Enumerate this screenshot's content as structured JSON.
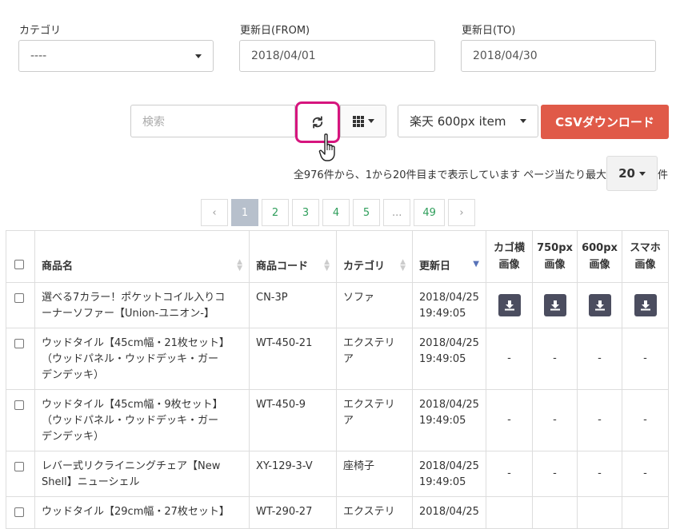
{
  "filters": {
    "category": {
      "label": "カテゴリ",
      "value": "----"
    },
    "date_from": {
      "label": "更新日(FROM)",
      "value": "2018/04/01"
    },
    "date_to": {
      "label": "更新日(TO)",
      "value": "2018/04/30"
    }
  },
  "toolbar": {
    "search_placeholder": "検索",
    "format_select": "楽天 600px item",
    "csv_button": "CSVダウンロード"
  },
  "info": {
    "text": "全976件から、1から20件目まで表示しています ページ当たり最大",
    "per_page": "20",
    "suffix": "件"
  },
  "pagination": {
    "prev": "‹",
    "pages": [
      "1",
      "2",
      "3",
      "4",
      "5",
      "...",
      "49"
    ],
    "current": "1",
    "next": "›"
  },
  "table": {
    "headers": {
      "name": "商品名",
      "code": "商品コード",
      "category": "カテゴリ",
      "updated": "更新日",
      "img1": [
        "カゴ横",
        "画像"
      ],
      "img2": [
        "750px",
        "画像"
      ],
      "img3": [
        "600px",
        "画像"
      ],
      "img4": [
        "スマホ",
        "画像"
      ]
    },
    "rows": [
      {
        "name": [
          "選べる7カラー！ポケットコイル入りコ",
          "ーナーソファー【Union-ユニオン-】"
        ],
        "code": "CN-3P",
        "category": [
          "ソファ"
        ],
        "updated": [
          "2018/04/25",
          "19:49:05"
        ],
        "images": [
          "download",
          "download",
          "download",
          "download"
        ]
      },
      {
        "name": [
          "ウッドタイル【45cm幅・21枚セット】",
          "（ウッドパネル・ウッドデッキ・ガー",
          "デンデッキ）"
        ],
        "code": "WT-450-21",
        "category": [
          "エクステリ",
          "ア"
        ],
        "updated": [
          "2018/04/25",
          "19:49:05"
        ],
        "images": [
          "-",
          "-",
          "-",
          "-"
        ]
      },
      {
        "name": [
          "ウッドタイル【45cm幅・9枚セット】",
          "（ウッドパネル・ウッドデッキ・ガー",
          "デンデッキ）"
        ],
        "code": "WT-450-9",
        "category": [
          "エクステリ",
          "ア"
        ],
        "updated": [
          "2018/04/25",
          "19:49:05"
        ],
        "images": [
          "-",
          "-",
          "-",
          "-"
        ]
      },
      {
        "name": [
          "レバー式リクライニングチェア【New",
          "Shell】ニューシェル"
        ],
        "code": "XY-129-3-V",
        "category": [
          "座椅子"
        ],
        "updated": [
          "2018/04/25",
          "19:49:05"
        ],
        "images": [
          "-",
          "-",
          "-",
          "-"
        ]
      },
      {
        "name": [
          "ウッドタイル【29cm幅・27枚セット】"
        ],
        "code": "WT-290-27",
        "category": [
          "エクステリ"
        ],
        "updated": [
          "2018/04/25"
        ],
        "images": [
          "",
          "",
          "",
          ""
        ]
      }
    ]
  },
  "colors": {
    "accent": "#e05a48",
    "highlight": "#d6157e",
    "link": "#2f9e5b",
    "icon_bg": "#4b4d5f"
  }
}
